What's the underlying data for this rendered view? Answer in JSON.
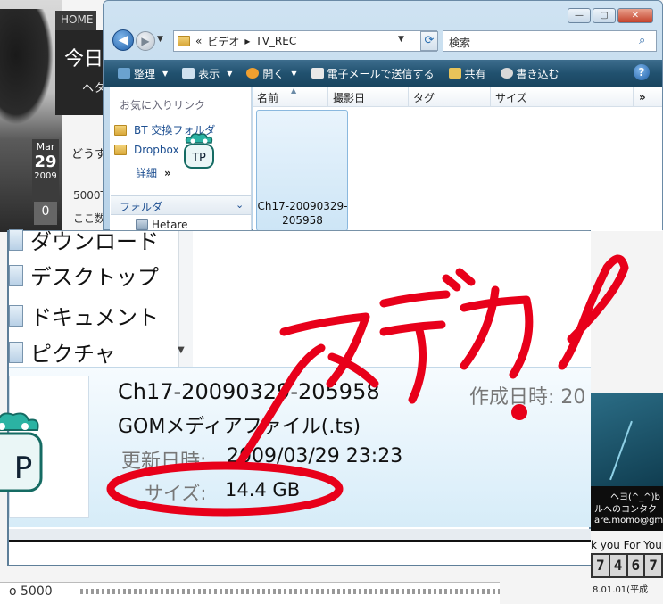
{
  "blog": {
    "home_tab": "HOME",
    "header_title": "今日",
    "header_sub": "ヘタ",
    "date_month": "Mar",
    "date_day": "29",
    "date_year": "2009",
    "post_title": "どうす",
    "post_line1": "5000T",
    "post_line2": "ここ数",
    "count": "0",
    "contact_line1": "ヘヨ(^_^)b",
    "contact_line2": "ルへのコンタク",
    "contact_line3": "are.momo@gm",
    "thanks": "k you For Your",
    "counter_digits": [
      "7",
      "4",
      "6",
      "7"
    ],
    "since": "8.01.01(平成",
    "footer_text": "o 5000"
  },
  "window": {
    "caption_buttons": [
      "—",
      "▢",
      "✕"
    ],
    "breadcrumb": [
      "«",
      "ビデオ",
      "▸",
      "TV_REC"
    ],
    "search_placeholder": "検索",
    "toolbar": [
      {
        "label": "整理",
        "icon": "organize-icon",
        "has_arrow": true
      },
      {
        "label": "表示",
        "icon": "views-icon",
        "has_arrow": true
      },
      {
        "label": "開く",
        "icon": "open-icon",
        "has_arrow": true
      },
      {
        "label": "電子メールで送信する",
        "icon": "email-icon",
        "has_arrow": false
      },
      {
        "label": "共有",
        "icon": "share-icon",
        "has_arrow": false
      },
      {
        "label": "書き込む",
        "icon": "burn-icon",
        "has_arrow": false
      }
    ],
    "favorites_header": "お気に入りリンク",
    "favorites": [
      "BT 交換フォルダ",
      "Dropbox"
    ],
    "more_link": "詳細",
    "more_chevron": "»",
    "folders_label": "フォルダ",
    "tree_partial": "Hetare",
    "columns": [
      "名前",
      "撮影日",
      "タグ",
      "サイズ"
    ],
    "columns_more": "»",
    "file_name_line1": "Ch17-20090329-",
    "file_name_line2": "205958",
    "gom_badge": "TP"
  },
  "zoom": {
    "tree": [
      "ダウンロード",
      "デスクトップ",
      "ドキュメント",
      "ピクチャ"
    ],
    "details": {
      "name": "Ch17-20090329-205958",
      "type": "GOMメディアファイル(.ts)",
      "modified_label": "更新日時:",
      "modified_value": "2009/03/29 23:23",
      "size_label": "サイズ:",
      "size_value": "14.4 GB",
      "created_label": "作成日時: 20"
    },
    "gom_badge": "P"
  },
  "colors": {
    "toolbar_top": "#3d6d8d",
    "toolbar_bottom": "#1a4560",
    "scribble_red": "#e8001a",
    "gom_teal": "#2bb3a3"
  }
}
